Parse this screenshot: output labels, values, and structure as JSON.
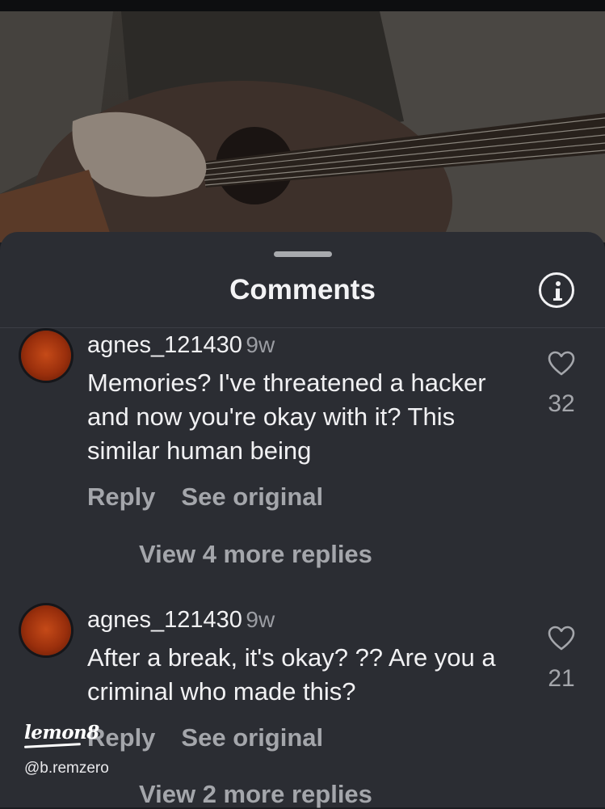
{
  "sheet": {
    "title": "Comments",
    "info_icon": "info-icon"
  },
  "comments": [
    {
      "username": "agnes_121430",
      "time_ago": "9w",
      "text": "Memories? I've threatened a hacker and now you're okay with it? This similar human being",
      "reply_label": "Reply",
      "see_original_label": "See original",
      "likes": "32",
      "more_replies_label": "View 4 more replies"
    },
    {
      "username": "agnes_121430",
      "time_ago": "9w",
      "text": "After a break, it's okay? ?? Are you a criminal who made this?",
      "reply_label": "Reply",
      "see_original_label": "See original",
      "likes": "21",
      "more_replies_label": "View 2 more replies"
    }
  ],
  "watermark": {
    "logo": "lemon8",
    "handle": "@b.remzero"
  },
  "colors": {
    "sheet_bg": "#2b2d33",
    "text_primary": "#f1f1f3",
    "text_secondary": "#a4a6ab"
  }
}
